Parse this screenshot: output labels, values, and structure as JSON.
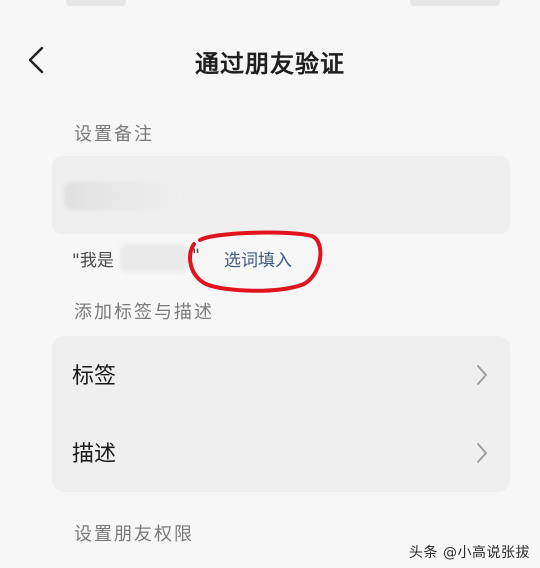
{
  "nav": {
    "title": "通过朋友验证"
  },
  "remark": {
    "section_label": "设置备注"
  },
  "hint": {
    "prefix": "\"我是",
    "suffix": "\"",
    "fill_link": "选词填入"
  },
  "tags_section": {
    "section_label": "添加标签与描述",
    "items": [
      {
        "label": "标签"
      },
      {
        "label": "描述"
      }
    ]
  },
  "permissions": {
    "section_label": "设置朋友权限"
  },
  "watermark": "头条 @小高说张拔",
  "colors": {
    "link": "#3d5a80",
    "annotation": "#e0141e",
    "card": "#efefef"
  }
}
